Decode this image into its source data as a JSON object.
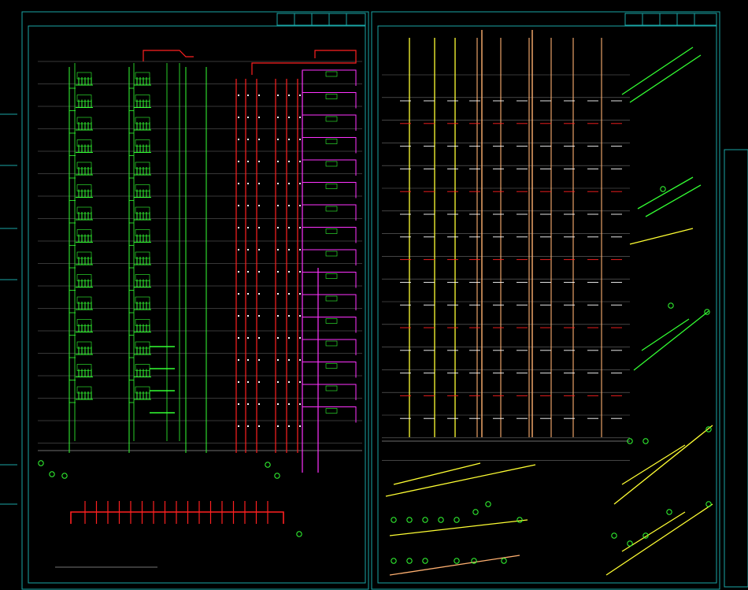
{
  "colors": {
    "background": "#000000",
    "frame": "#1aa6a6",
    "floorline": "#6e6e6e",
    "water_supply": "#33ff33",
    "fire_hydrant": "#ff2020",
    "spray": "#ff33ff",
    "drain_yellow": "#ffff33",
    "drain_orange": "#ffb070",
    "note": "#e8e8e8",
    "marker": "#33ff33"
  },
  "sheets": [
    {
      "name": "left-sheet"
    },
    {
      "name": "right-sheet"
    }
  ],
  "captions": {
    "left_bottom": "",
    "right_mid": "",
    "right_bottom": "",
    "iso_1": "",
    "iso_2": ""
  },
  "diagram_type": "CAD plumbing riser system drawing"
}
